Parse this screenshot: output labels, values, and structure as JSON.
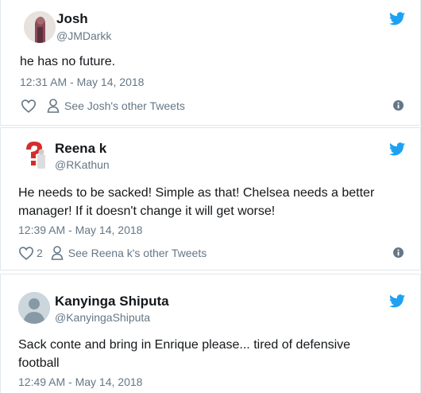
{
  "tweets": [
    {
      "name": "Josh",
      "handle": "@JMDarkk",
      "text": "he has no future.",
      "time": "12:31 AM - May 14, 2018",
      "likes": "",
      "see_other": "See Josh's other Tweets"
    },
    {
      "name": "Reena k",
      "handle": "@RKathun",
      "text": "He needs to be sacked! Simple as that! Chelsea needs a better manager! If it doesn't change it will get worse!",
      "time": "12:39 AM - May 14, 2018",
      "likes": "2",
      "see_other": "See Reena k's other Tweets"
    },
    {
      "name": "Kanyinga Shiputa",
      "handle": "@KanyingaShiputa",
      "text": "Sack conte and bring in Enrique please... tired of defensive football",
      "time": "12:49 AM - May 14, 2018"
    }
  ],
  "icons": {
    "brand": "twitter-bird-icon",
    "like": "heart-icon",
    "profile": "person-icon",
    "info": "info-icon"
  },
  "colors": {
    "twitter_blue": "#1da1f2",
    "secondary_text": "#657786",
    "border": "#e1e8ed"
  }
}
